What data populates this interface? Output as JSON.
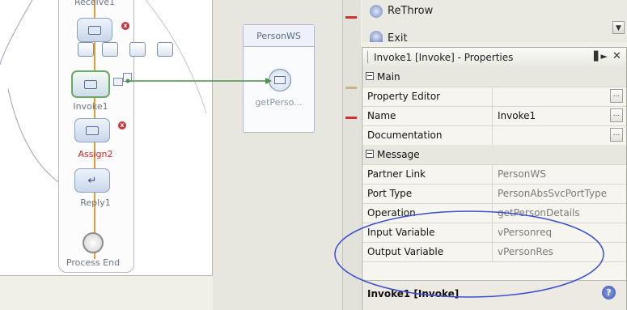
{
  "canvas": {
    "receive_label": "Receive1",
    "invoke_label": "Invoke1",
    "assign_label": "Assign2",
    "reply_label": "Reply1",
    "process_end_label": "Process End",
    "error_glyph": "x"
  },
  "partner": {
    "title": "PersonWS",
    "operation_label": "getPerso..."
  },
  "palette": {
    "rethrow_label": "ReThrow",
    "exit_label": "Exit"
  },
  "properties": {
    "title": "Invoke1 [Invoke] - Properties",
    "sections": {
      "main": "Main",
      "message": "Message"
    },
    "rows": {
      "property_editor": "Property Editor",
      "name": "Name",
      "name_value": "Invoke1",
      "documentation": "Documentation",
      "partner_link": "Partner Link",
      "partner_link_value": "PersonWS",
      "port_type": "Port Type",
      "port_type_value": "PersonAbsSvcPortType",
      "operation": "Operation",
      "operation_value": "getPersonDetails",
      "input_variable": "Input Variable",
      "input_variable_value": "vPersonreq",
      "output_variable": "Output Variable",
      "output_variable_value": "vPersonRes"
    },
    "ellipsis": "...",
    "footer_title": "Invoke1 [Invoke]",
    "help_glyph": "?"
  },
  "colors": {
    "error_badge": "#c8343c",
    "selected_border": "#6aa86a",
    "link_line": "#4d8f4d",
    "flow_wire": "#e0a030",
    "annotation_ellipse": "#3a4fd0"
  }
}
